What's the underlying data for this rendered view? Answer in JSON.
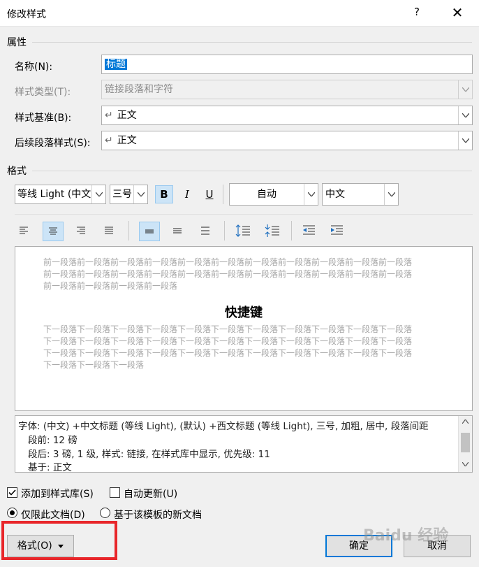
{
  "window": {
    "title": "修改样式",
    "help": "?",
    "close": "✕"
  },
  "properties": {
    "header": "属性",
    "name_label": "名称(N):",
    "name_value": "标题",
    "type_label": "样式类型(T):",
    "type_value": "链接段落和字符",
    "based_label": "样式基准(B):",
    "based_value": "正文",
    "next_label": "后续段落样式(S):",
    "next_value": "正文",
    "para_mark": "↵"
  },
  "format": {
    "header": "格式",
    "font_value": "等线 Light (中文",
    "size_value": "三号",
    "bold": "B",
    "italic": "I",
    "underline": "U",
    "color_value": "自动",
    "script_value": "中文"
  },
  "preview": {
    "prev_lines": [
      "前一段落前一段落前一段落前一段落前一段落前一段落前一段落前一段落前一段落前一段落前一段落",
      "前一段落前一段落前一段落前一段落前一段落前一段落前一段落前一段落前一段落前一段落前一段落",
      "前一段落前一段落前一段落前一段落"
    ],
    "heading": "快捷键",
    "next_lines": [
      "下一段落下一段落下一段落下一段落下一段落下一段落下一段落下一段落下一段落下一段落下一段落",
      "下一段落下一段落下一段落下一段落下一段落下一段落下一段落下一段落下一段落下一段落下一段落",
      "下一段落下一段落下一段落下一段落下一段落下一段落下一段落下一段落下一段落下一段落下一段落",
      "下一段落下一段落下一段落"
    ]
  },
  "description": {
    "lines": [
      "字体: (中文) +中文标题 (等线 Light), (默认) +西文标题 (等线 Light), 三号, 加粗, 居中, 段落间距",
      "段前: 12 磅",
      "段后: 3 磅, 1 级, 样式: 链接, 在样式库中显示, 优先级: 11",
      "基于: 正文"
    ]
  },
  "options": {
    "add_to_gallery": "添加到样式库(S)",
    "auto_update": "自动更新(U)",
    "only_this_doc": "仅限此文档(D)",
    "new_docs_template": "基于该模板的新文档"
  },
  "buttons": {
    "format": "格式(O)",
    "ok": "确定",
    "cancel": "取消"
  },
  "watermark": "Baidu 经验"
}
